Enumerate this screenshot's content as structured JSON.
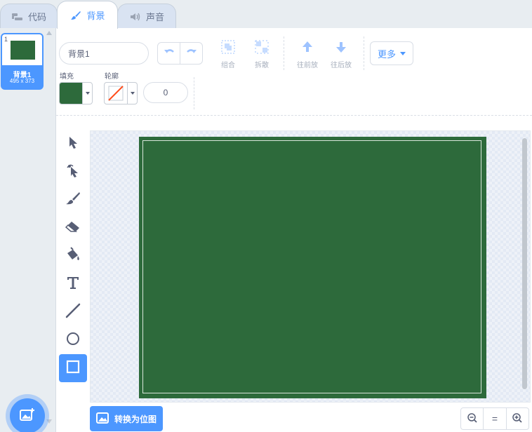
{
  "tabs": [
    {
      "label": "代码",
      "icon": "code-blocks-icon"
    },
    {
      "label": "背景",
      "icon": "paintbrush-icon"
    },
    {
      "label": "声音",
      "icon": "speaker-icon"
    }
  ],
  "costume_list": {
    "items": [
      {
        "number": "1",
        "name": "背景1",
        "size": "495 x 373",
        "thumb_color": "#2d6a3b"
      }
    ],
    "add_icon": "add-backdrop-icon"
  },
  "editor": {
    "costume_name": "背景1",
    "toolbar": {
      "group_label": "组合",
      "ungroup_label": "拆散",
      "forward_label": "往前放",
      "backward_label": "往后放",
      "more_label": "更多"
    },
    "fill": {
      "label": "填充",
      "color": "#2d6a3b"
    },
    "outline": {
      "label": "轮廓",
      "color": "none",
      "width": "0"
    },
    "tools": [
      "select-icon",
      "reshape-icon",
      "brush-icon",
      "eraser-icon",
      "fill-bucket-icon",
      "text-icon",
      "line-icon",
      "circle-icon",
      "rectangle-icon"
    ],
    "active_tool": "rectangle-icon",
    "canvas": {
      "backdrop_color": "#2d6a3b",
      "outline_color": "#d9e6dc"
    },
    "convert_label": "转换为位图",
    "zoom": {
      "out_icon": "zoom-out-icon",
      "reset_label": "=",
      "in_icon": "zoom-in-icon"
    }
  },
  "colors": {
    "accent": "#4c97ff",
    "text": "#575e75",
    "disabled": "#a7afbd"
  }
}
